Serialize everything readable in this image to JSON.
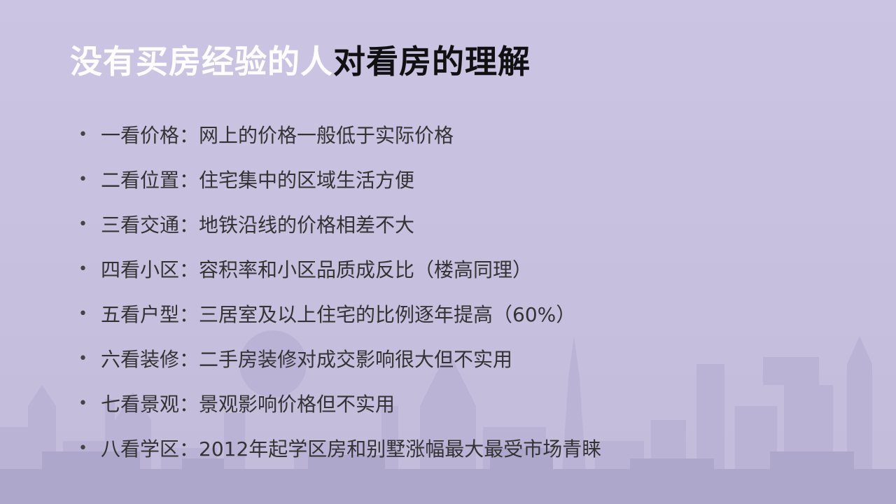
{
  "slide": {
    "title_part1": "没有买房经验的人",
    "title_part2": "对看房的理解",
    "bullet_glyph": "•",
    "bullets": [
      "一看价格：网上的价格一般低于实际价格",
      "二看位置：住宅集中的区域生活方便",
      "三看交通：地铁沿线的价格相差不大",
      "四看小区：容积率和小区品质成反比（楼高同理）",
      "五看户型：三居室及以上住宅的比例逐年提高（60%）",
      "六看装修：二手房装修对成交影响很大但不实用",
      "七看景观：景观影响价格但不实用",
      "八看学区：2012年起学区房和别墅涨幅最大最受市场青睐"
    ]
  },
  "colors": {
    "background": "#c8c2e0",
    "title_highlight": "#ffffff",
    "title_dark": "#111111",
    "body_text": "#333333",
    "skyline": "#b3acd0"
  }
}
